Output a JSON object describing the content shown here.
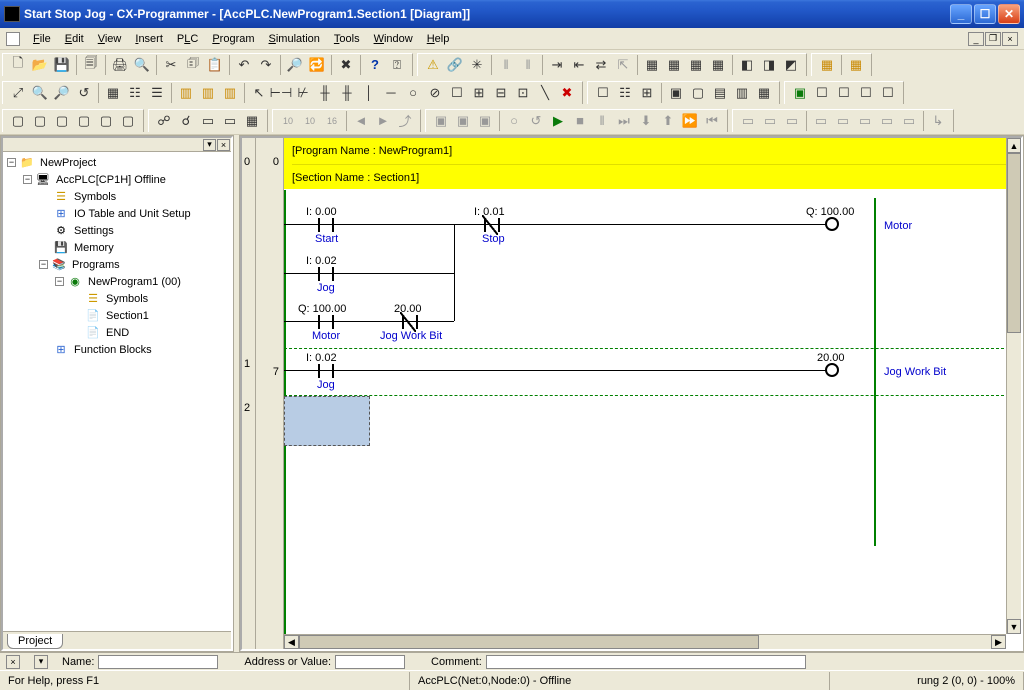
{
  "title": "Start Stop Jog - CX-Programmer - [AccPLC.NewProgram1.Section1 [Diagram]]",
  "menu": {
    "file": "File",
    "edit": "Edit",
    "view": "View",
    "insert": "Insert",
    "plc": "PLC",
    "program": "Program",
    "simulation": "Simulation",
    "tools": "Tools",
    "window": "Window",
    "help": "Help"
  },
  "tree": {
    "root": "NewProject",
    "plc": "AccPLC[CP1H] Offline",
    "symbols": "Symbols",
    "iotable": "IO Table and Unit Setup",
    "settings": "Settings",
    "memory": "Memory",
    "programs": "Programs",
    "newprog": "NewProgram1 (00)",
    "p_symbols": "Symbols",
    "section": "Section1",
    "end": "END",
    "fb": "Function Blocks",
    "tab": "Project"
  },
  "diagram": {
    "program_header": "[Program Name : NewProgram1]",
    "section_header": "[Section Name : Section1]",
    "rung0": "0",
    "rung1": "1",
    "rung2": "2",
    "col0": "0",
    "col7": "7",
    "start_addr": "I: 0.00",
    "start_lbl": "Start",
    "stop_addr": "I: 0.01",
    "stop_lbl": "Stop",
    "jog_addr": "I: 0.02",
    "jog_lbl": "Jog",
    "motor_out_addr": "Q: 100.00",
    "motor_lbl": "Motor",
    "motor_in_addr": "Q: 100.00",
    "motor_in_lbl": "Motor",
    "jogwb_addr": "20.00",
    "jogwb_lbl": "Jog Work Bit",
    "jog2_addr": "I: 0.02",
    "jog2_lbl": "Jog",
    "jogwb_out_addr": "20.00",
    "jogwb_out_lbl": "Jog Work Bit"
  },
  "props": {
    "name": "Name:",
    "addr": "Address or Value:",
    "comment": "Comment:"
  },
  "status": {
    "help": "For Help, press F1",
    "conn": "AccPLC(Net:0,Node:0) - Offline",
    "rung": "rung 2 (0, 0) - 100%"
  }
}
